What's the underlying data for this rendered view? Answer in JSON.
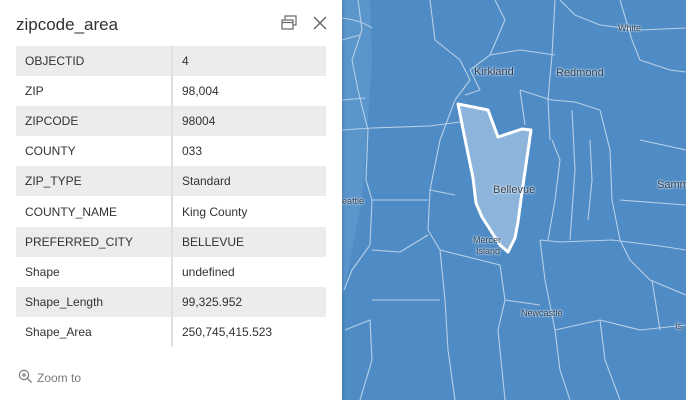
{
  "popup": {
    "title": "zipcode_area",
    "dock_icon": "dock-icon",
    "close_icon": "close-icon",
    "attributes": [
      {
        "key": "OBJECTID",
        "value": "4"
      },
      {
        "key": "ZIP",
        "value": "98,004"
      },
      {
        "key": "ZIPCODE",
        "value": "98004"
      },
      {
        "key": "COUNTY",
        "value": "033"
      },
      {
        "key": "ZIP_TYPE",
        "value": "Standard"
      },
      {
        "key": "COUNTY_NAME",
        "value": "King County"
      },
      {
        "key": "PREFERRED_CITY",
        "value": "BELLEVUE"
      },
      {
        "key": "Shape",
        "value": "undefined"
      },
      {
        "key": "Shape_Length",
        "value": "99,325.952"
      },
      {
        "key": "Shape_Area",
        "value": "250,745,415.523"
      }
    ],
    "zoom_label": "Zoom to",
    "zoom_icon": "zoom-in-icon"
  },
  "map": {
    "labels": {
      "white": "White",
      "kirkland": "Kirkland",
      "redmond": "Redmond",
      "bellevue": "Bellevue",
      "seattle": "eattle",
      "mercer": "Mercer",
      "island": "Island",
      "newcastle": "Newcastle",
      "samm": "Samm",
      "is": "Is"
    },
    "colors": {
      "zip_fill": "#4f8cc6",
      "selected_fill": "#8db5db",
      "boundary": "#b7cfe6",
      "selection_outline": "#ffffff"
    }
  }
}
